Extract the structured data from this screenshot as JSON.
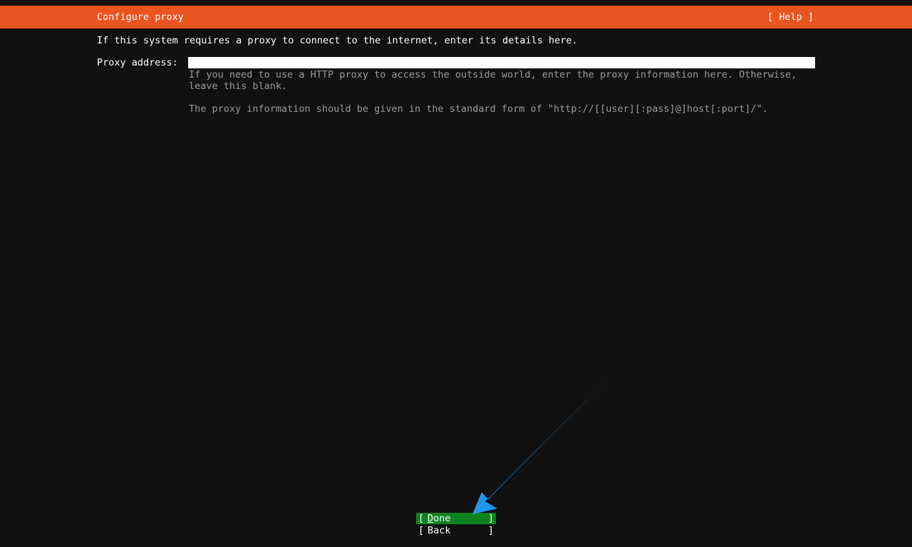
{
  "header": {
    "title": "Configure proxy",
    "help_label": "[ Help ]"
  },
  "intro_text": "If this system requires a proxy to connect to the internet, enter its details here.",
  "proxy": {
    "label": "Proxy address:",
    "value": "",
    "help_line_1": "If you need to use a HTTP proxy to access the outside world, enter the proxy information here. Otherwise,\nleave this blank.",
    "help_line_2": "The proxy information should be given in the standard form of \"http://[[user][:pass]@]host[:port]/\"."
  },
  "buttons": {
    "done_first": "D",
    "done_rest": "one",
    "back_label": "Back"
  },
  "colors": {
    "header_bg": "#e95420",
    "done_bg": "#0e8420",
    "annotation_arrow": "#2196f3"
  }
}
